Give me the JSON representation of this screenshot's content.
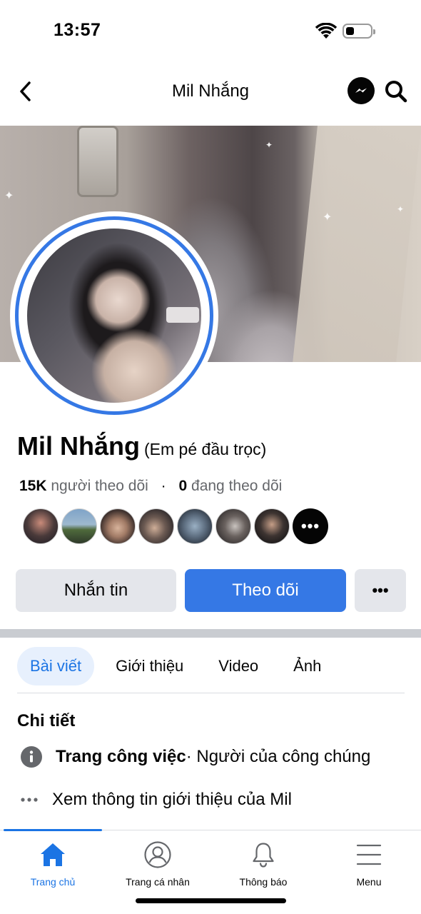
{
  "status_bar": {
    "time": "13:57"
  },
  "header": {
    "title": "Mil Nhắng",
    "back_icon": "chevron-left-icon",
    "messenger_icon": "messenger-icon",
    "search_icon": "search-icon"
  },
  "profile": {
    "name": "Mil Nhắng",
    "alternate_name": "(Em pé đầu trọc)",
    "followers_count": "15K",
    "followers_label": "người theo dõi",
    "following_count": "0",
    "following_label": "đang theo dõi",
    "more_followers_icon": "•••"
  },
  "actions": {
    "message_label": "Nhắn tin",
    "follow_label": "Theo dõi",
    "more_label": "•••"
  },
  "tabs": [
    {
      "label": "Bài viết",
      "active": true
    },
    {
      "label": "Giới thiệu",
      "active": false
    },
    {
      "label": "Video",
      "active": false
    },
    {
      "label": "Ảnh",
      "active": false
    }
  ],
  "details": {
    "title": "Chi tiết",
    "page_type_bold": "Trang công việc",
    "page_type_rest": " · Người của công chúng",
    "see_about": "Xem thông tin giới thiệu của Mil"
  },
  "bottom_nav": [
    {
      "label": "Trang chủ",
      "icon": "home-icon",
      "active": true
    },
    {
      "label": "Trang cá nhân",
      "icon": "profile-icon",
      "active": false
    },
    {
      "label": "Thông báo",
      "icon": "bell-icon",
      "active": false
    },
    {
      "label": "Menu",
      "icon": "menu-icon",
      "active": false
    }
  ],
  "colors": {
    "accent": "#1b74e4",
    "follow_button": "#3578e5",
    "secondary_button": "#e4e6eb",
    "avatar_ring": "#3578e5"
  }
}
